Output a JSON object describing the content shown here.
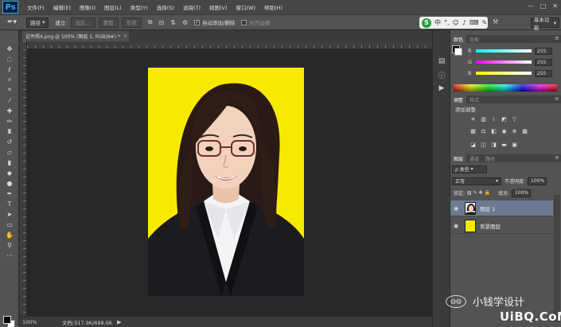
{
  "app": {
    "logo": "Ps",
    "menu": [
      "文件(F)",
      "编辑(E)",
      "图像(I)",
      "图层(L)",
      "类型(Y)",
      "选择(S)",
      "滤镜(T)",
      "视图(V)",
      "窗口(W)",
      "帮助(H)"
    ],
    "window_controls": [
      "—",
      "□",
      "✕"
    ]
  },
  "options_bar": {
    "tool_mode": "路径",
    "build_label": "建立:",
    "buttons": [
      "选区...",
      "蒙版",
      "形状"
    ],
    "auto_add_delete_label": "自动添加/删除",
    "auto_add_delete_checked": true,
    "align_edges_label": "对齐边缘",
    "align_edges_checked": false,
    "workspace": "基本功能"
  },
  "document": {
    "tab_title": "证件照4.png @ 100% (图层 1, RGB/8#) *",
    "close_glyph": "×",
    "zoom": "100%",
    "doc_info": "文档:517.9K/698.6K",
    "status_arrow": "▶"
  },
  "color_panel": {
    "tabs": [
      "颜色",
      "色板"
    ],
    "sliders": [
      {
        "label": "R",
        "value": "255",
        "color": "#ff3030"
      },
      {
        "label": "G",
        "value": "255",
        "color": "#ff30ff"
      },
      {
        "label": "B",
        "value": "255",
        "color": "#ffff30"
      }
    ]
  },
  "adjustments_panel": {
    "tabs": [
      "调整",
      "样式"
    ],
    "title": "添加调整"
  },
  "layers_panel": {
    "tabs": [
      "图层",
      "通道",
      "路径"
    ],
    "filter_label": "ρ 类型",
    "blend_mode": "正常",
    "opacity_label": "不透明度:",
    "opacity_value": "100%",
    "lock_label": "锁定:",
    "fill_label": "填充:",
    "fill_value": "100%",
    "layers": [
      {
        "name": "图层 1",
        "selected": true,
        "thumb": "portrait"
      },
      {
        "name": "背景图层",
        "selected": false,
        "thumb": "#f7e900"
      }
    ]
  },
  "photo": {
    "background_color": "#f7e900"
  },
  "watermark": {
    "text": "小钱学设计",
    "site": "UiBQ.CoM"
  }
}
